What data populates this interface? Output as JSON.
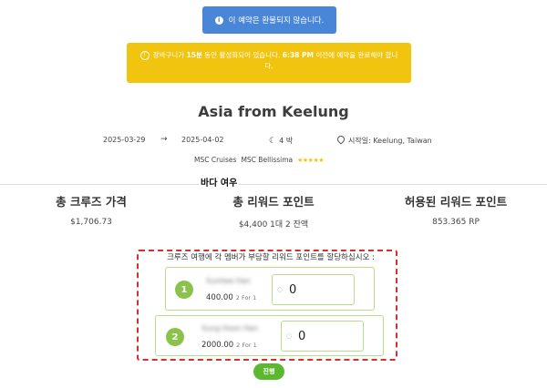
{
  "info_banner": {
    "text": "이 예약은 환불되지 않습니다.",
    "icon": "info-icon"
  },
  "warning_banner": {
    "text_before": "장바구니가 ",
    "minutes": "15분",
    "text_mid": " 동안 활성화되어 있습니다. ",
    "time": "6:38 PM",
    "text_after": " 이전에 예약을 완료해야 합니다."
  },
  "cruise": {
    "title": "Asia from Keelung",
    "start_date": "2025-03-29",
    "end_date": "2025-04-02",
    "nights": "4 박",
    "departure": "시작일: Keelung, Taiwan",
    "line": "MSC Cruises",
    "ship": "MSC Bellissima",
    "stars": "★★★★★",
    "cabin_type": "바다 여우"
  },
  "summary": [
    {
      "label": "총 크루즈 가격",
      "value": "$1,706.73"
    },
    {
      "label": "총 리워드 포인트",
      "value": "$4,400 1대 2 잔액"
    },
    {
      "label": "허용된 리워드 포인트",
      "value": "853.365 RP"
    }
  ],
  "allocation": {
    "instruction": "크루즈 여행에 각 멤버가 부담할 리워드 포인트를 할당하십시오 :",
    "members": [
      {
        "num": "1",
        "name": "Sunhee Han",
        "price": "400.00",
        "sub": "2 For 1",
        "points": "0"
      },
      {
        "num": "2",
        "name": "Sung Hoon Han",
        "price": "2000.00",
        "sub": "2 For 1",
        "points": "0"
      }
    ]
  },
  "proceed_label": "진행",
  "colors": {
    "info": "#4a86d8",
    "warning": "#f1c40f",
    "accent_green": "#5cb82e",
    "dash_red": "#d32f2f"
  }
}
